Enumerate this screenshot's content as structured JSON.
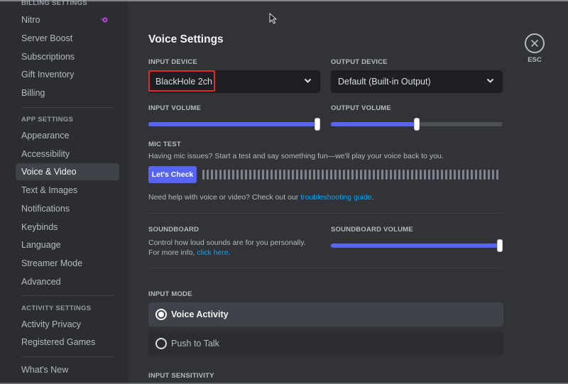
{
  "sidebar": {
    "sections": [
      {
        "header": "Billing Settings",
        "items": [
          {
            "label": "Nitro",
            "icon": "nitro-icon"
          },
          {
            "label": "Server Boost"
          },
          {
            "label": "Subscriptions"
          },
          {
            "label": "Gift Inventory"
          },
          {
            "label": "Billing"
          }
        ]
      },
      {
        "header": "App Settings",
        "items": [
          {
            "label": "Appearance"
          },
          {
            "label": "Accessibility"
          },
          {
            "label": "Voice & Video",
            "active": true
          },
          {
            "label": "Text & Images"
          },
          {
            "label": "Notifications"
          },
          {
            "label": "Keybinds"
          },
          {
            "label": "Language"
          },
          {
            "label": "Streamer Mode"
          },
          {
            "label": "Advanced"
          }
        ]
      },
      {
        "header": "Activity Settings",
        "items": [
          {
            "label": "Activity Privacy"
          },
          {
            "label": "Registered Games"
          }
        ]
      },
      {
        "header": "",
        "items": [
          {
            "label": "What's New"
          }
        ]
      }
    ]
  },
  "main": {
    "title": "Voice Settings",
    "input_device": {
      "label": "Input Device",
      "value": "BlackHole 2ch",
      "highlighted": true
    },
    "output_device": {
      "label": "Output Device",
      "value": "Default (Built-in Output)"
    },
    "input_volume": {
      "label": "Input Volume",
      "percent": 100
    },
    "output_volume": {
      "label": "Output Volume",
      "percent": 50
    },
    "mic_test": {
      "label": "Mic Test",
      "description": "Having mic issues? Start a test and say something fun—we'll play your voice back to you.",
      "button": "Let's Check",
      "meter_level": 0
    },
    "help": {
      "prefix": "Need help with voice or video? Check out our ",
      "link": "troubleshooting guide",
      "suffix": "."
    },
    "soundboard": {
      "label": "Soundboard",
      "description_prefix": "Control how loud sounds are for you personally. For more info, ",
      "link": "click here",
      "suffix": "."
    },
    "soundboard_volume": {
      "label": "Soundboard Volume",
      "percent": 100
    },
    "input_mode": {
      "label": "Input Mode",
      "options": [
        {
          "label": "Voice Activity",
          "selected": true
        },
        {
          "label": "Push to Talk",
          "selected": false
        }
      ]
    },
    "input_sensitivity": {
      "label": "Input Sensitivity"
    },
    "close": {
      "label": "ESC"
    }
  },
  "colors": {
    "accent": "#5865f2",
    "link": "#00a8fc",
    "highlight_box": "#e02b2b",
    "nitro": "#d946ef"
  }
}
